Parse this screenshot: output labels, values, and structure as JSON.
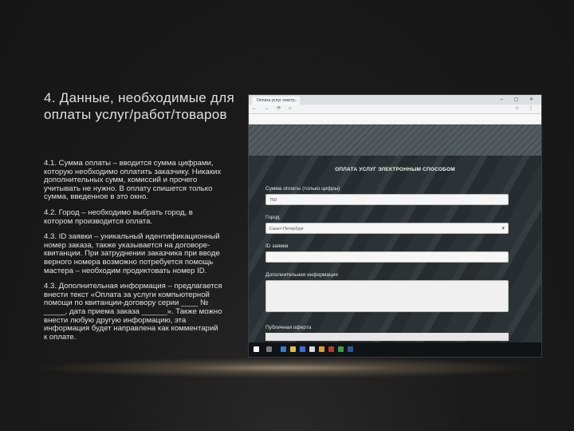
{
  "slide": {
    "title": "4. Данные, необходимые для оплаты услуг/работ/товаров",
    "paragraphs": [
      "4.1. Сумма оплаты – вводится сумма цифрами, которую необходимо оплатить заказчику. Никаких дополнительных сумм, комиссий и прочего учитывать не нужно. В оплату спишется только сумма, введенное в это окно.",
      "4.2. Город – необходимо выбрать город, в котором производится оплата.",
      "4.3. ID заявки – уникальный идентификационный номер заказа, также указывается на договоре-квитанции. При затруднении заказчика при вводе верного номера возможно потребуется помощь мастера – необходим продиктовать номер ID.",
      "4.3. Дополнительная информация – предлагается внести текст «Оплата за услуги компьютерной помощи по квитанции-договору серии ____ № _____, дата приема заказа ______». Также можно внести любую другую информацию, эта информация будет направлена как комментарий к оплате."
    ]
  },
  "browser": {
    "tab_title": "Оплата услуг электр...",
    "window_controls": "– ▢ ✕",
    "nav_icons": "← → ⟳ ⌂",
    "url": "",
    "toolbar_right": "☆ ⋮",
    "bookmarks_label": "",
    "logo_text": "",
    "page": {
      "heading": "ОПЛАТА УСЛУГ ЭЛЕКТРОННЫМ СПОСОБОМ",
      "fields": [
        {
          "label": "Сумма оплаты (только цифры)",
          "value": "750"
        },
        {
          "label": "Город",
          "value": "Санкт-Петербург"
        },
        {
          "label": "ID заявки",
          "value": ""
        }
      ],
      "extra_label": "Дополнительная информация",
      "extra_value": "",
      "recaptcha_text": "",
      "offer_label": "Публичная оферта",
      "offer_text": ""
    },
    "taskbar_clock": ""
  }
}
